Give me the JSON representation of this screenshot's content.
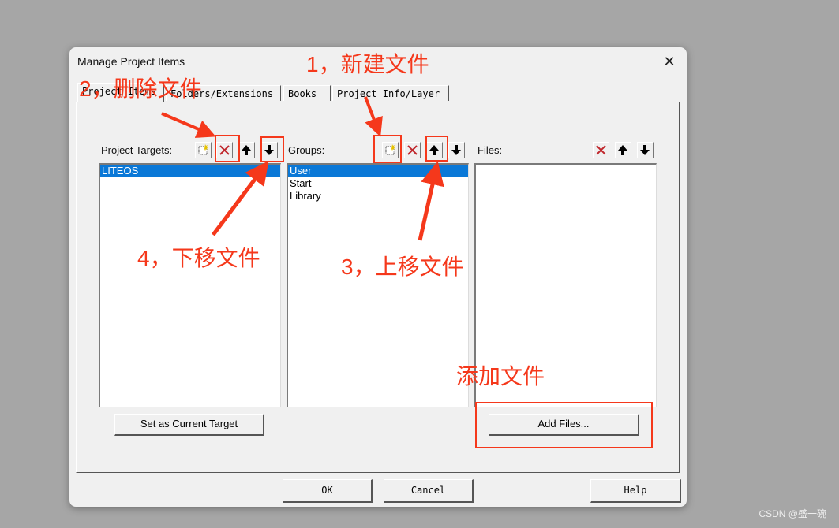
{
  "dialog": {
    "title": "Manage Project Items",
    "close_glyph": "✕"
  },
  "tabs": [
    {
      "label": "Project Items"
    },
    {
      "label": "Folders/Extensions"
    },
    {
      "label": "Books"
    },
    {
      "label": "Project Info/Layer"
    }
  ],
  "panes": {
    "targets": {
      "label": "Project Targets:",
      "items": [
        "LITEOS"
      ],
      "selected_index": 0,
      "toolbar": [
        "new-icon",
        "delete-icon",
        "move-up-icon",
        "move-down-icon"
      ]
    },
    "groups": {
      "label": "Groups:",
      "items": [
        "User",
        "Start",
        "Library"
      ],
      "selected_index": 0,
      "toolbar": [
        "new-icon",
        "delete-icon",
        "move-up-icon",
        "move-down-icon"
      ]
    },
    "files": {
      "label": "Files:",
      "items": [],
      "toolbar": [
        "delete-icon",
        "move-up-icon",
        "move-down-icon"
      ]
    }
  },
  "buttons": {
    "set_current_target": "Set as Current Target",
    "add_files": "Add Files...",
    "ok": "OK",
    "cancel": "Cancel",
    "help": "Help"
  },
  "annotations": {
    "new_file": "1，新建文件",
    "delete_file": "2，删除文件",
    "move_up": "3，上移文件",
    "move_down": "4，下移文件",
    "add_file": "添加文件"
  },
  "colors": {
    "annotation": "#f5381b",
    "selection": "#0a78d7",
    "delete_icon": "#c0282d"
  },
  "watermark": "CSDN @盛一碗"
}
